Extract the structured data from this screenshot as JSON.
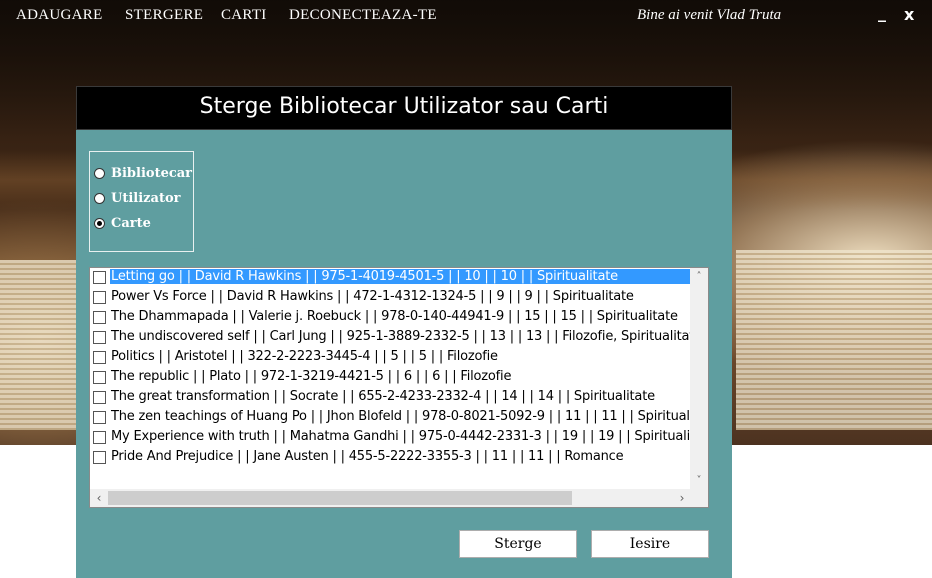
{
  "menu": {
    "add": "ADAUGARE",
    "delete": "STERGERE",
    "books": "CARTI",
    "logout": "DECONECTEAZA-TE"
  },
  "welcome": "Bine ai venit Vlad Truta",
  "window_controls": {
    "minimize": "_",
    "close": "x"
  },
  "dialog": {
    "title": "Sterge Bibliotecar Utilizator sau Carti",
    "radios": [
      {
        "label": "Bibliotecar",
        "checked": false
      },
      {
        "label": "Utilizator",
        "checked": false
      },
      {
        "label": "Carte",
        "checked": true
      }
    ],
    "list": [
      "Letting go  | | David R Hawkins | | 975-1-4019-4501-5 | | 10 | | 10 | | Spiritualitate",
      "Power Vs Force | | David R Hawkins  | | 472-1-4312-1324-5 | | 9 | | 9 | | Spiritualitate",
      "The Dhammapada | | Valerie j. Roebuck | | 978-0-140-44941-9 | | 15 | | 15 | | Spiritualitate",
      "The undiscovered self | | Carl Jung | | 925-1-3889-2332-5 | | 13 | | 13 | | Filozofie, Spiritualitate",
      "Politics | | Aristotel | | 322-2-2223-3445-4 | | 5 | | 5 | | Filozofie",
      "The republic | | Plato | | 972-1-3219-4421-5 | | 6 | | 6 | | Filozofie",
      "The great transformation | | Socrate | | 655-2-4233-2332-4 | | 14 | | 14 | | Spiritualitate",
      "The zen teachings of Huang Po | | Jhon Blofeld | | 978-0-8021-5092-9 | | 11 | | 11 | | Spiritualitate",
      "My Experience with truth | | Mahatma Gandhi | | 975-0-4442-2331-3 | | 19 | | 19 | | Spiritualitate",
      "Pride And Prejudice | | Jane Austen | | 455-5-2222-3355-3 | | 11 | | 11 | | Romance"
    ],
    "selected_index": 0,
    "buttons": {
      "delete": "Sterge",
      "exit": "Iesire"
    }
  },
  "scroll_glyphs": {
    "up": "˄",
    "down": "˅",
    "left": "‹",
    "right": "›"
  }
}
